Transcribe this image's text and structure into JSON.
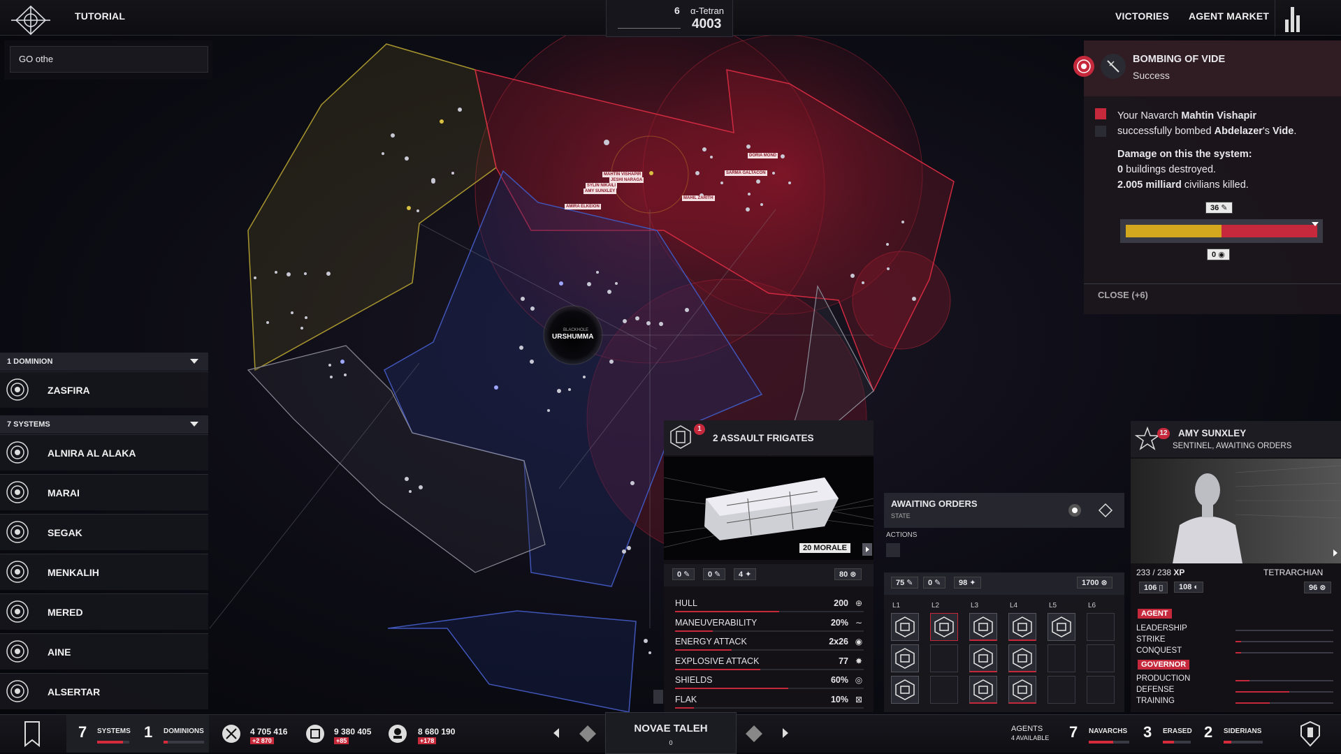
{
  "topbar": {
    "tutorial": "TUTORIAL",
    "score_count": "6",
    "score_faction": "α-Tetran",
    "score_value": "4003",
    "victories": "VICTORIES",
    "agent_market": "AGENT MARKET"
  },
  "search": {
    "value": "GO othe"
  },
  "left_list": {
    "dominion_header": "1 DOMINION",
    "dominions": [
      "ZASFIRA"
    ],
    "systems_header": "7 SYSTEMS",
    "systems": [
      "ALNIRA AL ALAKA",
      "MARAI",
      "SEGAK",
      "MENKALIH",
      "MERED",
      "AINE",
      "ALSERTAR"
    ]
  },
  "map_labels": {
    "blackhole_caption": "BLACKHOLE",
    "blackhole_name": "URSHUMMA",
    "fleet_names": [
      "MAHTIN VISHAPIR",
      "JESHI NARAGA",
      "SYLIN NIKAILI",
      "AMY SUNXLEY",
      "AMIRA ELKEION",
      "MAHIL ZARITH",
      "SARMA GALTACON",
      "DORIA MOND"
    ]
  },
  "notification": {
    "title": "BOMBING OF VIDE",
    "subtitle": "Success",
    "line1_pre": "Your Navarch ",
    "line1_name": "Mahtin Vishapir",
    "line2_pre": "successfully bombed ",
    "line2_target": "Abdelazer",
    "line2_post": "'s ",
    "line2_planet": "Vide",
    "line2_end": ".",
    "damage_header": "Damage on this the system:",
    "buildings_num": "0",
    "buildings_text": " buildings destroyed.",
    "civilians_num": "2.005 milliard",
    "civilians_text": " civilians killed.",
    "attack_value": "36",
    "defense_value": "0",
    "bar_yellow_fraction": 0.5,
    "close_label": "CLOSE (+6)"
  },
  "fleet": {
    "badge": "1",
    "title": "2 ASSAULT FRIGATES",
    "morale": "20 MORALE",
    "summary": {
      "a": "0",
      "b": "0",
      "c": "4",
      "d": "80"
    },
    "stats": [
      {
        "name": "HULL",
        "value": "200",
        "fill": 0.55
      },
      {
        "name": "MANEUVERABILITY",
        "value": "20%",
        "fill": 0.2
      },
      {
        "name": "ENERGY ATTACK",
        "value": "2x26",
        "fill": 0.3
      },
      {
        "name": "EXPLOSIVE ATTACK",
        "value": "77",
        "fill": 0.45
      },
      {
        "name": "SHIELDS",
        "value": "60%",
        "fill": 0.6
      },
      {
        "name": "FLAK",
        "value": "10%",
        "fill": 0.1
      }
    ]
  },
  "orders": {
    "state_title": "AWAITING ORDERS",
    "state_label": "STATE",
    "actions_label": "ACTIONS",
    "summary": {
      "a": "75",
      "b": "0",
      "c": "98",
      "d": "1700"
    },
    "slot_headers": [
      "L1",
      "L2",
      "L3",
      "L4",
      "L5",
      "L6"
    ]
  },
  "admiral": {
    "badge": "12",
    "name": "AMY SUNXLEY",
    "status": "SENTINEL, AWAITING ORDERS",
    "xp": "233 / 238",
    "xp_label": "XP",
    "rank": "TETRARCHIAN",
    "chip1": "106",
    "chip2": "108",
    "chip3": "96",
    "agent_tag": "AGENT",
    "agent_skills": [
      "LEADERSHIP",
      "STRIKE",
      "CONQUEST"
    ],
    "governor_tag": "GOVERNOR",
    "governor_skills": [
      "PRODUCTION",
      "DEFENSE",
      "TRAINING"
    ]
  },
  "bottombar": {
    "systems_num": "7",
    "systems_label": "SYSTEMS",
    "dominions_num": "1",
    "dominions_label": "DOMINIONS",
    "res1": "4 705 416",
    "res1_delta": "+2 870",
    "res2": "9 380 405",
    "res2_delta": "+85",
    "res3": "8 680 190",
    "res3_delta": "+178",
    "location": "NOVAE TALEH",
    "location_sub": "0",
    "agents_label": "AGENTS",
    "agents_available": "4 AVAILABLE",
    "navarchs_num": "7",
    "navarchs_label": "NAVARCHS",
    "erased_num": "3",
    "erased_label": "ERASED",
    "siderians_num": "2",
    "siderians_label": "SIDERIANS"
  },
  "colors": {
    "accent_red": "#c7293c",
    "gold": "#c9a227",
    "territory_blue": "#3a4fa8",
    "territory_yellow": "#8a7a2a"
  }
}
